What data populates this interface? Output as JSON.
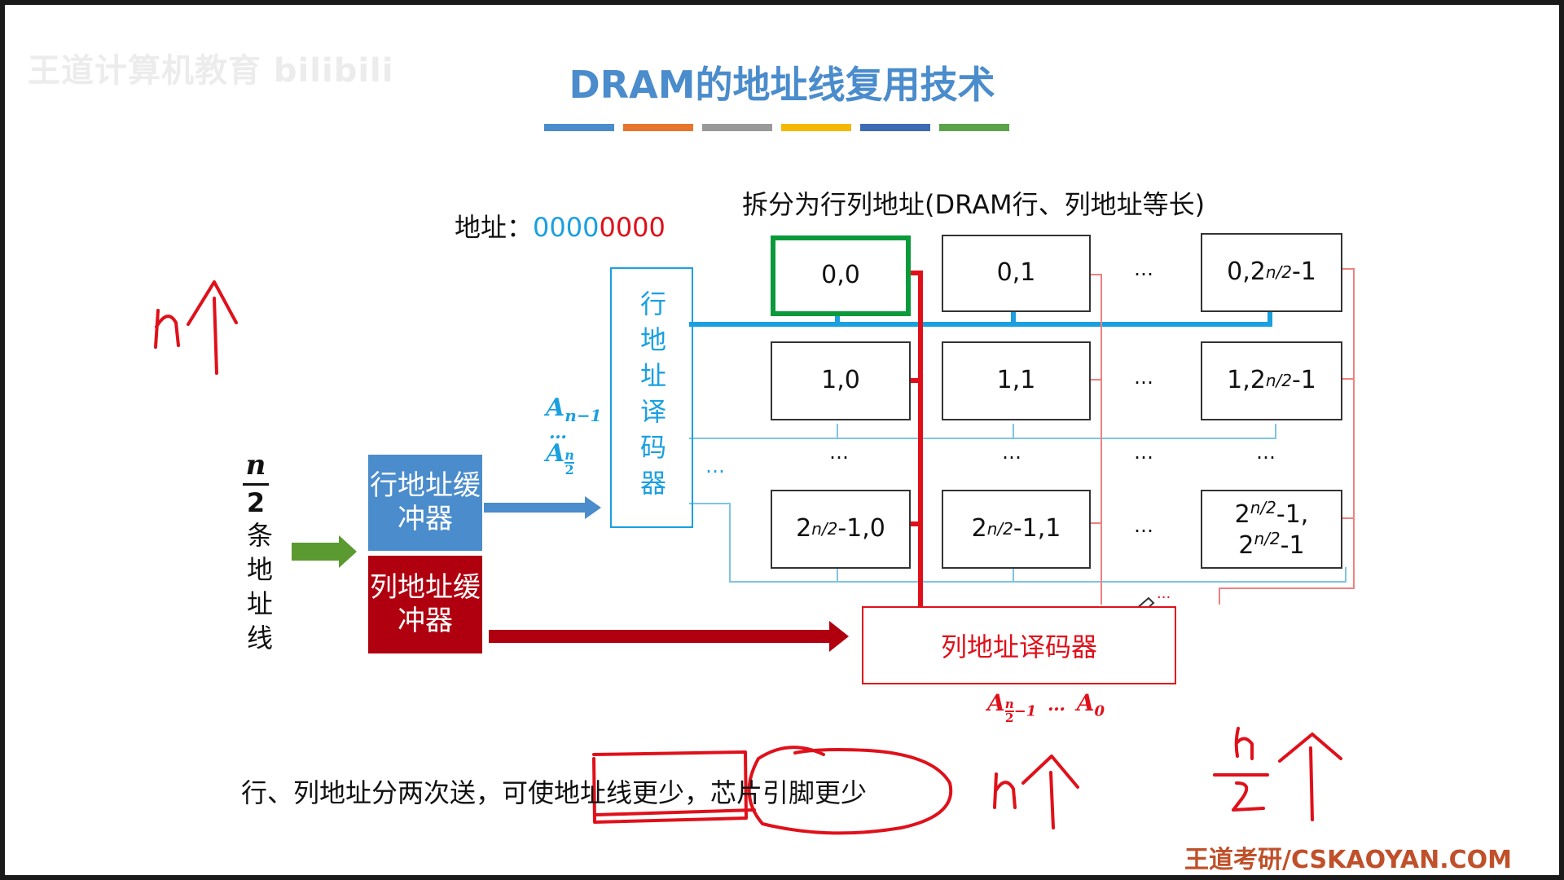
{
  "watermark": "王道计算机教育 bilibili",
  "title": "DRAM的地址线复用技术",
  "title_bar_colors": [
    "#4a8ccc",
    "#e8752d",
    "#999999",
    "#f5b800",
    "#3f6bb5",
    "#5aa34a"
  ],
  "address": {
    "label": "地址：",
    "bits_blue": "0000",
    "bits_red": "0000"
  },
  "split_caption": "拆分为行列地址(DRAM行、列地址等长)",
  "address_lines_label": {
    "numerator": "n",
    "denominator": "2",
    "text": "条地址线"
  },
  "row_buffer": "行地址缓冲器",
  "col_buffer": "列地址缓冲器",
  "row_decoder": "行地址译码器",
  "col_decoder": "列地址译码器",
  "row_input_label": {
    "top": "A",
    "top_sub": "n−1",
    "dots": "…",
    "bottom": "A",
    "bottom_sub_num": "n",
    "bottom_sub_den": "2"
  },
  "col_input_label": {
    "a": "A",
    "a_sub_num": "n",
    "a_sub_den": "2",
    "a_sub_tail": "−1",
    "dots": "…",
    "b": "A",
    "b_sub": "0"
  },
  "cells": {
    "r0c0": "0,0",
    "r0c1": "0,1",
    "r0cn_main": "0,2",
    "r0cn_sup": "n/2",
    "r0cn_tail": "-1",
    "r1c0": "1,0",
    "r1c1": "1,1",
    "r1cn_main": "1,2",
    "r1cn_sup": "n/2",
    "r1cn_tail": "-1",
    "rnc0_main": "2",
    "rnc0_sup": "n/2",
    "rnc0_tail": "-1,0",
    "rnc1_main": "2",
    "rnc1_sup": "n/2",
    "rnc1_tail": "-1,1",
    "rncn_line1_main": "2",
    "rncn_line1_sup": "n/2",
    "rncn_line1_tail": "-1,",
    "rncn_line2_main": "2",
    "rncn_line2_sup": "n/2",
    "rncn_line2_tail": "-1"
  },
  "ellipsis": "…",
  "vdots": "…",
  "bottom_text": {
    "part1": "行、列地址分两次送，可使",
    "part2": "地址线更少",
    "part3": "，",
    "part4": "芯片引脚更少"
  },
  "handwriting": {
    "left": "n个",
    "mid": "n个",
    "right_num": "n",
    "right_den": "2",
    "right_char": "个"
  },
  "brand": "王道考研/CSKAOYAN.COM",
  "colors": {
    "blue": "#1aa0e0",
    "red": "#e0101a",
    "dark_red": "#b00010",
    "buffer_blue": "#4a8ccc",
    "buffer_red": "#b00010",
    "green_arrow": "#5a9a30",
    "green_border": "#0a9a3a"
  }
}
